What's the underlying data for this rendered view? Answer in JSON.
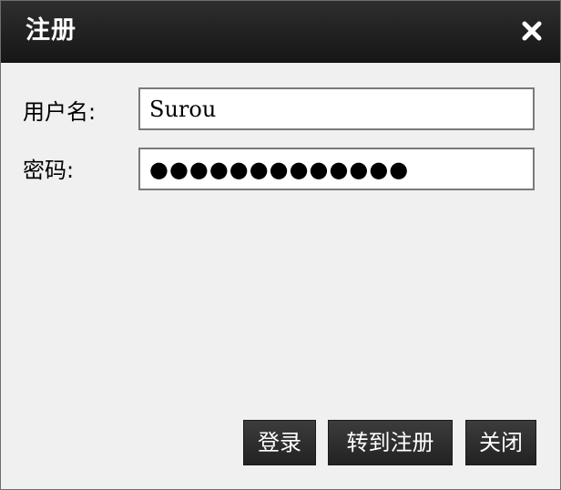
{
  "window": {
    "title": "注册"
  },
  "form": {
    "username_label": "用户名:",
    "username_value": "Surou",
    "password_label": "密码:",
    "password_value": "●●●●●●●●●●●●●"
  },
  "buttons": {
    "login": "登录",
    "go_register": "转到注册",
    "close": "关闭"
  },
  "icons": {
    "close": "close-icon"
  },
  "colors": {
    "titlebar": "#1f1f1f",
    "button_bg": "#2e2e2e",
    "window_bg": "#f0f0f0"
  }
}
